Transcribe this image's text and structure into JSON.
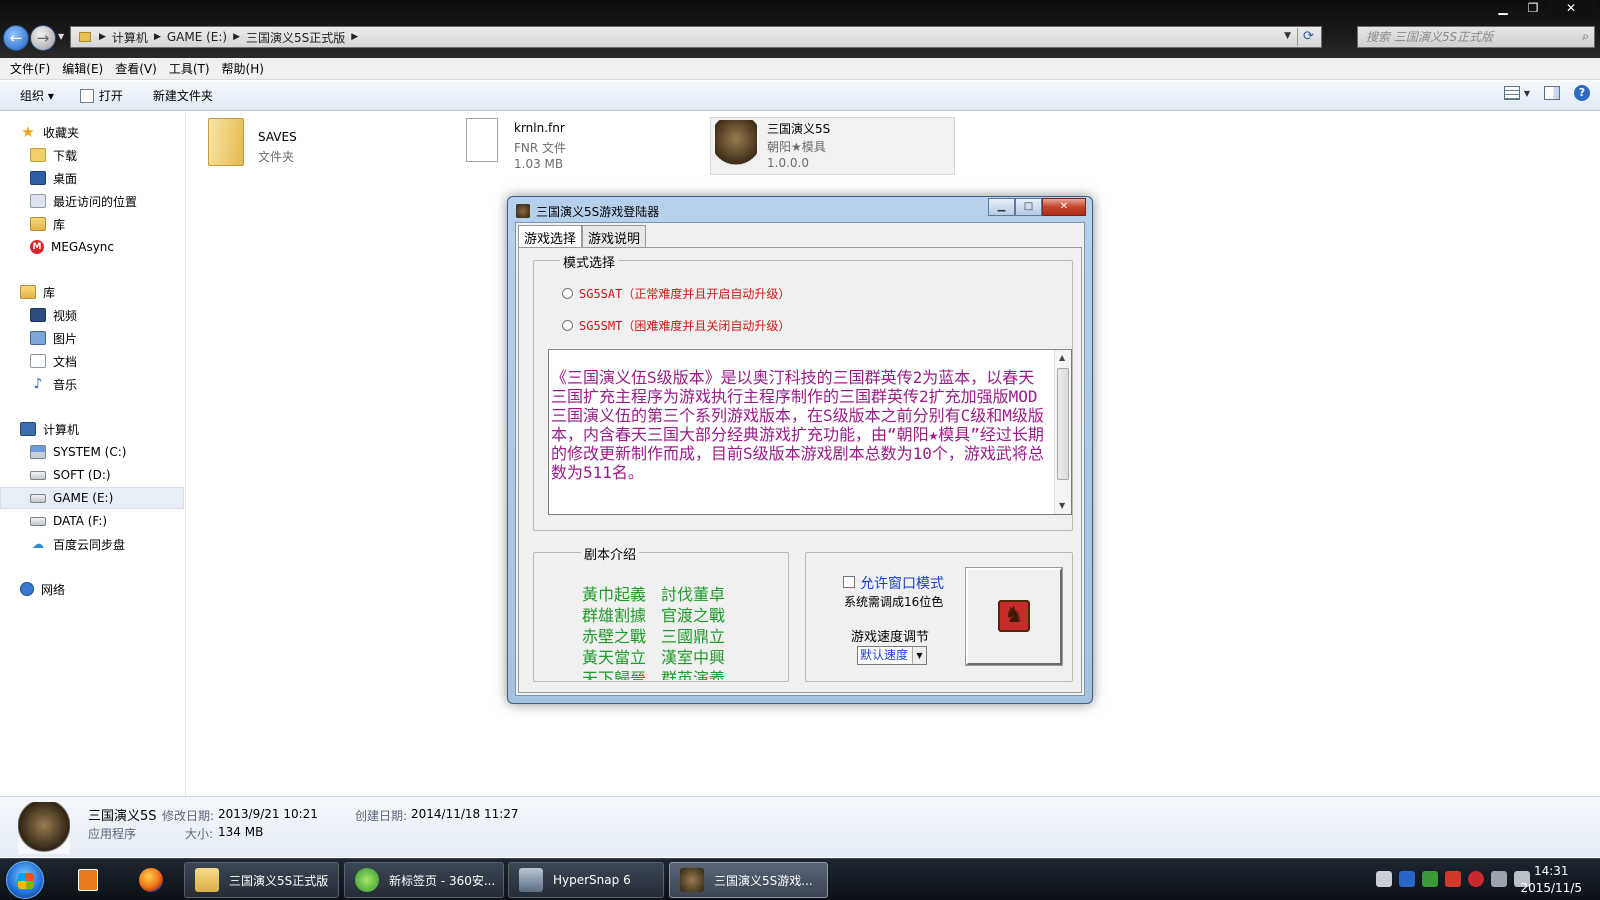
{
  "window": {
    "controls": [
      "minimize",
      "restore",
      "close"
    ]
  },
  "address": {
    "crumbs": [
      "计算机",
      "GAME (E:)",
      "三国演义5S正式版"
    ],
    "search_placeholder": "搜索 三国演义5S正式版"
  },
  "menu": [
    "文件(F)",
    "编辑(E)",
    "查看(V)",
    "工具(T)",
    "帮助(H)"
  ],
  "toolbar": {
    "organize": "组织 ▾",
    "open": "打开",
    "new_folder": "新建文件夹"
  },
  "sidebar": {
    "favorites": "收藏夹",
    "downloads": "下载",
    "desktop": "桌面",
    "recent": "最近访问的位置",
    "library_short": "库",
    "mega": "MEGAsync",
    "libraries": "库",
    "videos": "视频",
    "pictures": "图片",
    "documents": "文档",
    "music": "音乐",
    "computer": "计算机",
    "drive_c": "SYSTEM (C:)",
    "drive_d": "SOFT (D:)",
    "drive_e": "GAME (E:)",
    "drive_f": "DATA (F:)",
    "baidu": "百度云同步盘",
    "network": "网络"
  },
  "files": [
    {
      "name": "SAVES",
      "line1": "文件夹",
      "line2": ""
    },
    {
      "name": "krnln.fnr",
      "line1": "FNR 文件",
      "line2": "1.03 MB"
    },
    {
      "name": "三国演义5S",
      "line1": "朝阳★模具",
      "line2": "1.0.0.0"
    }
  ],
  "details": {
    "name": "三国演义5S",
    "type": "应用程序",
    "modified_label": "修改日期:",
    "modified": "2013/9/21 10:21",
    "size_label": "大小:",
    "size": "134 MB",
    "created_label": "创建日期:",
    "created": "2014/11/18 11:27"
  },
  "dialog": {
    "title": "三国演义5S游戏登陆器",
    "tabs": [
      "游戏选择",
      "游戏说明"
    ],
    "mode_group": "模式选择",
    "mode1": "SG5SAT（正常难度并且开启自动升级）",
    "mode2": "SG5SMT（困难难度并且关闭自动升级）",
    "description": "《三国演义伍S级版本》是以奥汀科技的三国群英传2为蓝本，以春天三国扩充主程序为游戏执行主程序制作的三国群英传2扩充加强版MOD三国演义伍的第三个系列游戏版本，在S级版本之前分别有C级和M级版本，内含春天三国大部分经典游戏扩充功能，由“朝阳★模具”经过长期的修改更新制作而成，目前S级版本游戏剧本总数为10个，游戏武将总数为511名。",
    "script_group": "剧本介绍",
    "scenarios": [
      "黃巾起義",
      "討伐董卓",
      "群雄割據",
      "官渡之戰",
      "赤壁之戰",
      "三國鼎立",
      "黃天當立",
      "漢室中興",
      "天下歸晉",
      "群英演義"
    ],
    "window_mode": "允许窗口模式",
    "color_note": "系统需调成16位色",
    "speed_label": "游戏速度调节",
    "speed_value": "默认速度"
  },
  "taskbar": {
    "tasks": [
      "三国演义5S正式版",
      "新标签页 - 360安...",
      "HyperSnap 6",
      "三国演义5S游戏..."
    ],
    "time": "14:31",
    "date": "2015/11/5"
  },
  "colors": {
    "mode_text": "#d01818",
    "description_text": "#9b1c8a",
    "scenario_text": "#1f9b2a",
    "option_text": "#1a3fd0"
  }
}
